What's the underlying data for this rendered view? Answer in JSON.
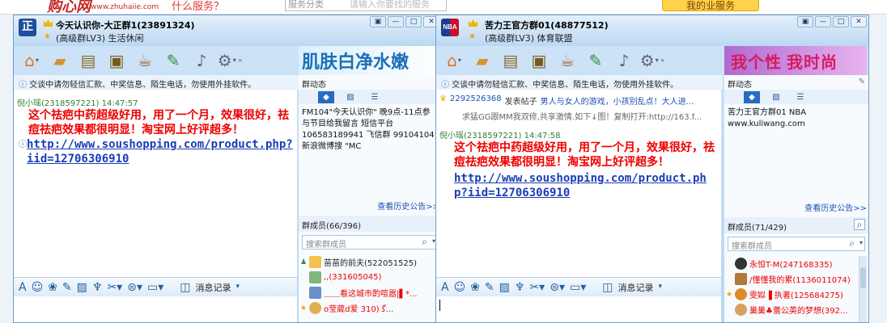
{
  "background_page": {
    "logo_text": "购心网",
    "url_text": "www.zhuhaiie.com",
    "tagline": "什么服务？",
    "search_select": "服务分类",
    "search_placeholder": "请输入你要找的服务",
    "button_label": "我的业服务"
  },
  "left_window": {
    "group_name": "今天认识你-大正群1(23891324)",
    "group_level": "(高级群LV3) 生活休闲",
    "banner_text": "肌肤白净水嫩",
    "notice": "交谈中请勿轻信汇款、中奖信息、陌生电话，勿使用外挂软件。",
    "messages": [
      {
        "sender": "倪小瑶(2318597221)  14:47:57",
        "text": "这个祛疤中药超级好用，用了一个月，效果很好，祛痘祛疤效果都很明显！淘宝网上好评超多！",
        "link": "http://www.soushopping.com/product.php?iid=12706306910"
      }
    ],
    "history_button": "消息记录",
    "side": {
      "dynamics_title": "群动态",
      "dynamics_text": "FM104\"今天认识你\" 晚9点-11点参与节目给我留言 短信平台10658318994​1 飞信群 99104104新浪微博搜 \"MC",
      "history_link": "查看历史公告>>",
      "members_title": "群成员(66/396)",
      "search_placeholder": "搜索群成员",
      "members": [
        {
          "name": "苗苗的前夫(522051525)",
          "color": "#222"
        },
        {
          "name": ",,(331605045)",
          "color": "#e00"
        },
        {
          "name": "＿＿看这城市酌喧嚣|▌*...",
          "color": "#e00"
        },
        {
          "name": "o莹葳d爱   ﮔ   (310...",
          "color": "#e00"
        }
      ]
    }
  },
  "right_window": {
    "group_name": "苦力王官方群01(48877512)",
    "group_level": "(高级群LV3) 体育联盟",
    "banner_text": "我个性 我时尚",
    "notice": "交谈中请勿轻信汇款、中奖信息、陌生电话，勿使用外挂软件。",
    "system_item": {
      "id": "2292526368",
      "action": "发表帖子",
      "title": "男人与女人的游戏，小孩别乱点！大人进...",
      "subline": "求猛GG跟MM我双修,共享激情.如下↓图！复制打开:http://163.f..."
    },
    "messages": [
      {
        "sender": "倪小瑶(2318597221)  14:47:58",
        "text": "这个祛疤中药超级好用，用了一个月，效果很好，祛痘祛疤效果都很明显！淘宝网上好评超多！",
        "link": "http://www.soushopping.com/product.php?iid=12706306910"
      }
    ],
    "history_button": "消息记录",
    "side": {
      "dynamics_title": "群动态",
      "dynamics_text": "苦力王官方群01 NBA\nwww.kuliwang.com",
      "history_link": "查看历史公告>>",
      "members_title": "群成员(71/429)",
      "search_placeholder": "搜索群成员",
      "members": [
        {
          "name": "永恒T-M(247168335)",
          "color": "#e00"
        },
        {
          "name": "/懂懂我的累(1136011074)",
          "color": "#e00"
        },
        {
          "name": "雯姒▐ 执著(125684275)",
          "color": "#e00"
        },
        {
          "name": "巢巢♣蕾公英的梦想(392...",
          "color": "#e00"
        }
      ]
    }
  },
  "colors": {
    "window_border": "#6b9bd1",
    "message_red": "#e00000",
    "link_blue": "#1a3db5",
    "sender_green": "#2e7d32"
  },
  "icons": {
    "toolbar": [
      "home-icon",
      "folder-icon",
      "album-icon",
      "tv-icon",
      "coffee-icon",
      "notes-icon",
      "microphone-icon",
      "gear-icon"
    ],
    "input": [
      "font-icon",
      "emoji-icon",
      "pet-icon",
      "edit-icon",
      "image-icon",
      "gift-icon",
      "scissors-icon",
      "vibrate-icon",
      "screen-icon",
      "history-icon"
    ]
  }
}
